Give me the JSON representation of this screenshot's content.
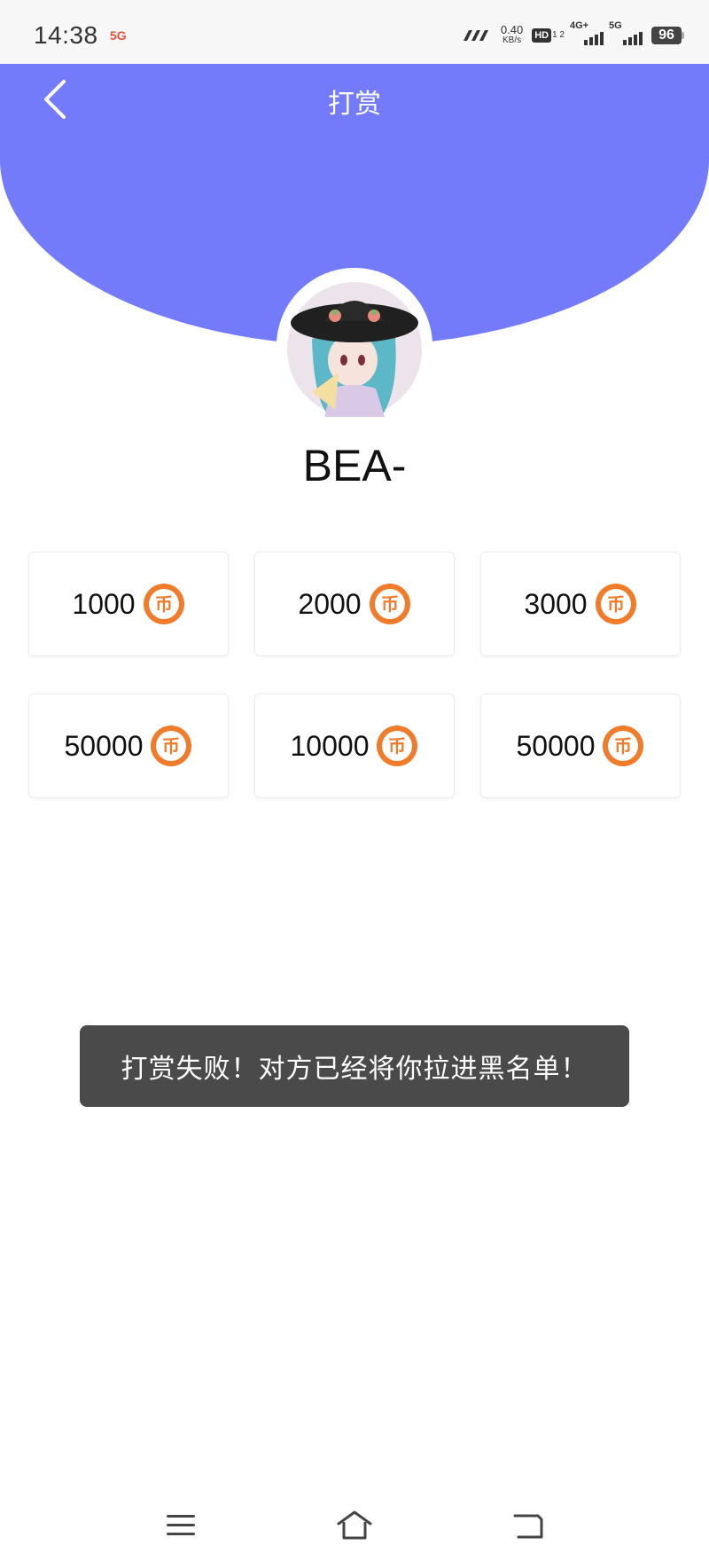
{
  "status_bar": {
    "time": "14:38",
    "network_badge": "5G",
    "speed_value": "0.40",
    "speed_unit": "KB/s",
    "hd_label": "HD",
    "hd_sub": "1 2",
    "sim1_label": "4G+",
    "sim2_label": "5G",
    "battery": "96"
  },
  "header": {
    "title": "打赏",
    "background_color": "#737bfb"
  },
  "user": {
    "name": "BEA-"
  },
  "rewards": [
    {
      "amount": "1000"
    },
    {
      "amount": "2000"
    },
    {
      "amount": "3000"
    },
    {
      "amount": "50000"
    },
    {
      "amount": "10000"
    },
    {
      "amount": "50000"
    }
  ],
  "coin": {
    "glyph": "币",
    "color": "#ef7b2b"
  },
  "toast": {
    "message": "打赏失败！对方已经将你拉进黑名单！"
  },
  "icons": {
    "back": "chevron-left-icon",
    "menu": "menu-icon",
    "home": "home-icon",
    "back_nav": "return-icon"
  }
}
